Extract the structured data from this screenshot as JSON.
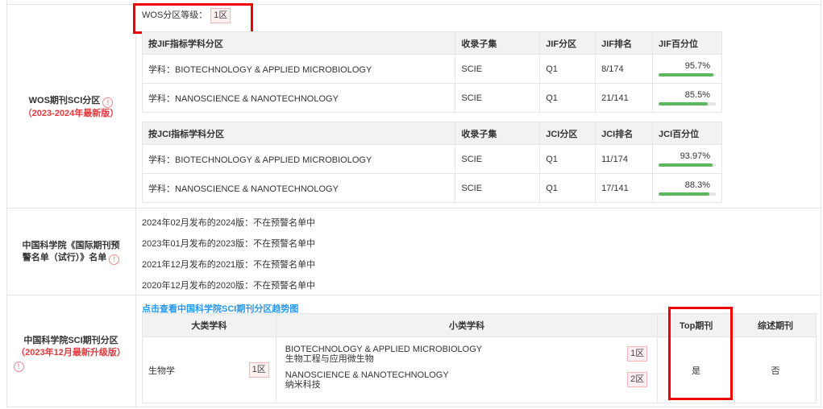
{
  "wos": {
    "label": "WOS期刊SCI分区",
    "edition": "（2023-2024年最新版）",
    "level_label": "WOS分区等级：",
    "level_value": "1区",
    "jif_table": {
      "headers": [
        "按JIF指标学科分区",
        "收录子集",
        "JIF分区",
        "JIF排名",
        "JIF百分位"
      ],
      "rows": [
        {
          "subject": "学科：BIOTECHNOLOGY & APPLIED MICROBIOLOGY",
          "collection": "SCIE",
          "quartile": "Q1",
          "rank": "8/174",
          "percentile": "95.7%",
          "percentile_value": 95.7
        },
        {
          "subject": "学科：NANOSCIENCE & NANOTECHNOLOGY",
          "collection": "SCIE",
          "quartile": "Q1",
          "rank": "21/141",
          "percentile": "85.5%",
          "percentile_value": 85.5
        }
      ]
    },
    "jci_table": {
      "headers": [
        "按JCI指标学科分区",
        "收录子集",
        "JCI分区",
        "JCI排名",
        "JCI百分位"
      ],
      "rows": [
        {
          "subject": "学科：BIOTECHNOLOGY & APPLIED MICROBIOLOGY",
          "collection": "SCIE",
          "quartile": "Q1",
          "rank": "11/174",
          "percentile": "93.97%",
          "percentile_value": 93.97
        },
        {
          "subject": "学科：NANOSCIENCE & NANOTECHNOLOGY",
          "collection": "SCIE",
          "quartile": "Q1",
          "rank": "17/141",
          "percentile": "88.3%",
          "percentile_value": 88.3
        }
      ]
    }
  },
  "warning": {
    "label": "中国科学院《国际期刊预警名单（试行）》名单",
    "lines": [
      "2024年02月发布的2024版：不在预警名单中",
      "2023年01月发布的2023版：不在预警名单中",
      "2021年12月发布的2021版：不在预警名单中",
      "2020年12月发布的2020版：不在预警名单中"
    ]
  },
  "cas": {
    "label": "中国科学院SCI期刊分区",
    "edition": "（2023年12月最新升级版）",
    "trend_link": "点击查看中国科学院SCI期刊分区趋势图",
    "headers": [
      "大类学科",
      "小类学科",
      "Top期刊",
      "综述期刊"
    ],
    "major_subject": "生物学",
    "major_zone": "1区",
    "minor_subjects": [
      {
        "en": "BIOTECHNOLOGY & APPLIED MICROBIOLOGY",
        "cn": "生物工程与应用微生物",
        "zone": "1区"
      },
      {
        "en": "NANOSCIENCE & NANOTECHNOLOGY",
        "cn": "纳米科技",
        "zone": "2区"
      }
    ],
    "top_journal": "是",
    "review_journal": "否"
  },
  "icons": {
    "info": "!"
  },
  "colors": {
    "accent_red": "#e4393c",
    "progress_green": "#5cb85c",
    "link_blue": "#2196f3",
    "highlight_box": "#e00000"
  }
}
